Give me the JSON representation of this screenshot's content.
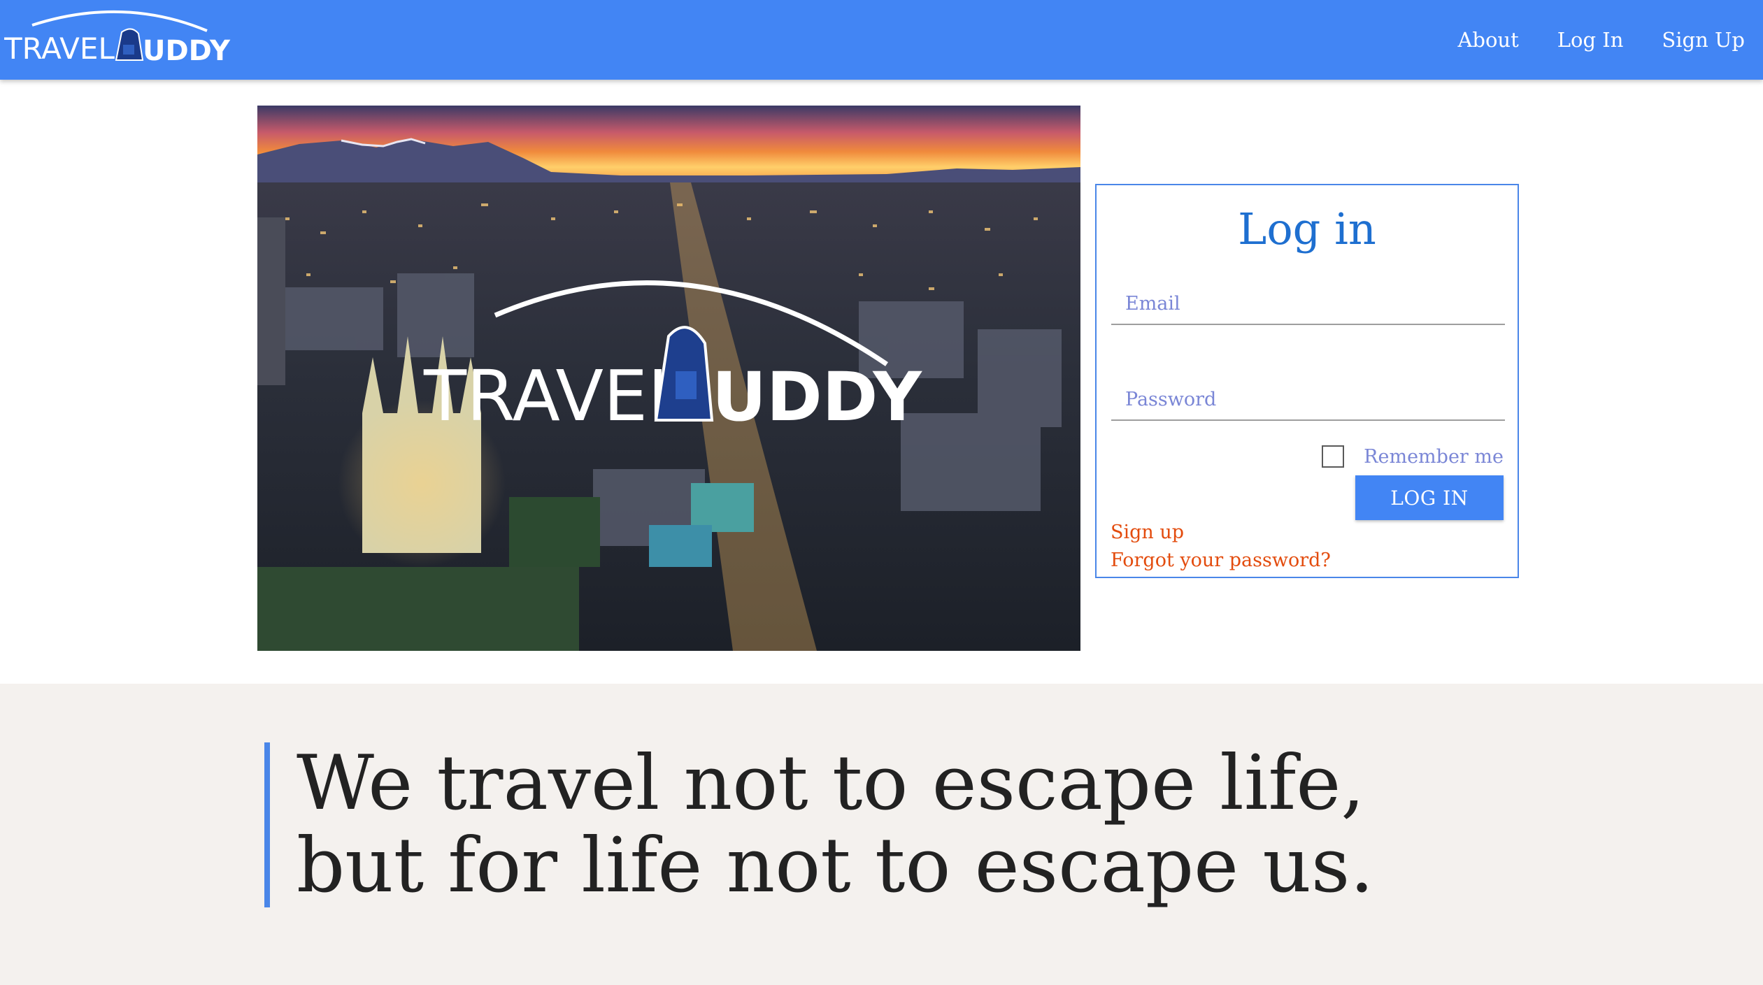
{
  "brand": {
    "name_left": "TRAVEL",
    "name_right": "UDDY",
    "logo_icon": "backpack-icon"
  },
  "nav": {
    "items": [
      {
        "label": "About"
      },
      {
        "label": "Log In"
      },
      {
        "label": "Sign Up"
      }
    ]
  },
  "hero": {
    "logo_left": "TRAVEL",
    "logo_right": "UDDY"
  },
  "login": {
    "title": "Log in",
    "email_placeholder": "Email",
    "password_placeholder": "Password",
    "remember_label": "Remember me",
    "button_label": "LOG IN",
    "signup_link": "Sign up",
    "forgot_link": "Forgot your password?"
  },
  "quote": {
    "line1": "We travel not to escape life,",
    "line2": "but for life not to escape us."
  },
  "colors": {
    "nav_bg": "#4285f4",
    "accent": "#1e6fd0",
    "link": "#e34c0e",
    "quote_bg": "#f4f1ee"
  }
}
